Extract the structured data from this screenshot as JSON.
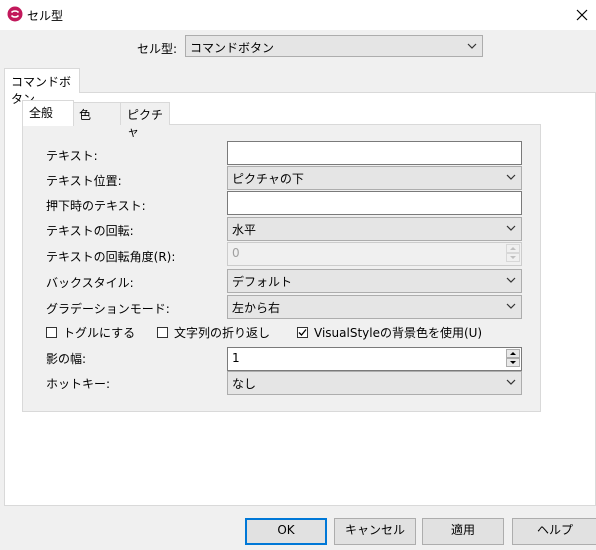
{
  "window": {
    "title": "セル型",
    "icon": "app-logo-icon",
    "close_icon": "close-icon"
  },
  "celltype": {
    "label": "セル型:",
    "value": "コマンドボタン"
  },
  "outer_tab": {
    "label": "コマンドボタン"
  },
  "inner_tabs": [
    "全般",
    "色",
    "ピクチャ"
  ],
  "fields": {
    "text": {
      "label": "テキスト:",
      "value": ""
    },
    "text_position": {
      "label": "テキスト位置:",
      "value": "ピクチャの下"
    },
    "pressed_text": {
      "label": "押下時のテキスト:",
      "value": ""
    },
    "text_rotation": {
      "label": "テキストの回転:",
      "value": "水平"
    },
    "rotation_angle": {
      "label": "テキストの回転角度(R):",
      "value": "0"
    },
    "back_style": {
      "label": "バックスタイル:",
      "value": "デフォルト"
    },
    "gradation_mode": {
      "label": "グラデーションモード:",
      "value": "左から右"
    },
    "shadow_width": {
      "label": "影の幅:",
      "value": "1"
    },
    "hotkey": {
      "label": "ホットキー:",
      "value": "なし"
    }
  },
  "checkboxes": {
    "toggle": {
      "label": "トグルにする",
      "checked": false
    },
    "wrap": {
      "label": "文字列の折り返し",
      "checked": false
    },
    "visualstyle": {
      "label": "VisualStyleの背景色を使用(U)",
      "checked": true
    }
  },
  "buttons": {
    "ok": "OK",
    "cancel": "キャンセル",
    "apply": "適用",
    "help": "ヘルプ"
  },
  "colors": {
    "accent": "#0078d7",
    "icon": "#c2185b"
  }
}
